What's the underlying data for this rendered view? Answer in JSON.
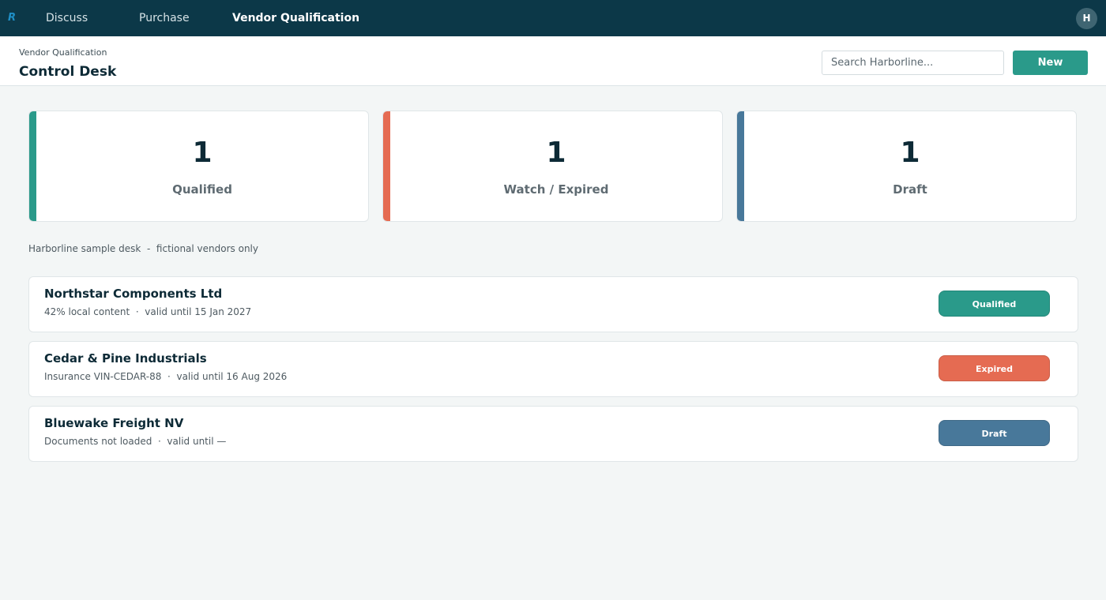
{
  "nav": {
    "logo": "R",
    "items": [
      {
        "label": "Discuss",
        "active": false
      },
      {
        "label": "Purchase",
        "active": false
      },
      {
        "label": "Vendor Qualification",
        "active": true
      }
    ],
    "avatar_initial": "H"
  },
  "header": {
    "breadcrumb": "Vendor Qualification",
    "title": "Control Desk",
    "search_placeholder": "Search Harborline...",
    "new_label": "New"
  },
  "summary": [
    {
      "count": "1",
      "label": "Qualified",
      "color": "#2a9a8a"
    },
    {
      "count": "1",
      "label": "Watch / Expired",
      "color": "#e56b52"
    },
    {
      "count": "1",
      "label": "Draft",
      "color": "#48789a"
    }
  ],
  "note": "Harborline sample desk  -  fictional vendors only",
  "vendors": [
    {
      "name": "Northstar Components Ltd",
      "meta": "42% local content  ·  valid until 15 Jan 2027",
      "status": "Qualified",
      "status_color": "#2a9a8a"
    },
    {
      "name": "Cedar & Pine Industrials",
      "meta": "Insurance VIN-CEDAR-88  ·  valid until 16 Aug 2026",
      "status": "Expired",
      "status_color": "#e56b52"
    },
    {
      "name": "Bluewake Freight NV",
      "meta": "Documents not loaded  ·  valid until —",
      "status": "Draft",
      "status_color": "#48789a"
    }
  ]
}
